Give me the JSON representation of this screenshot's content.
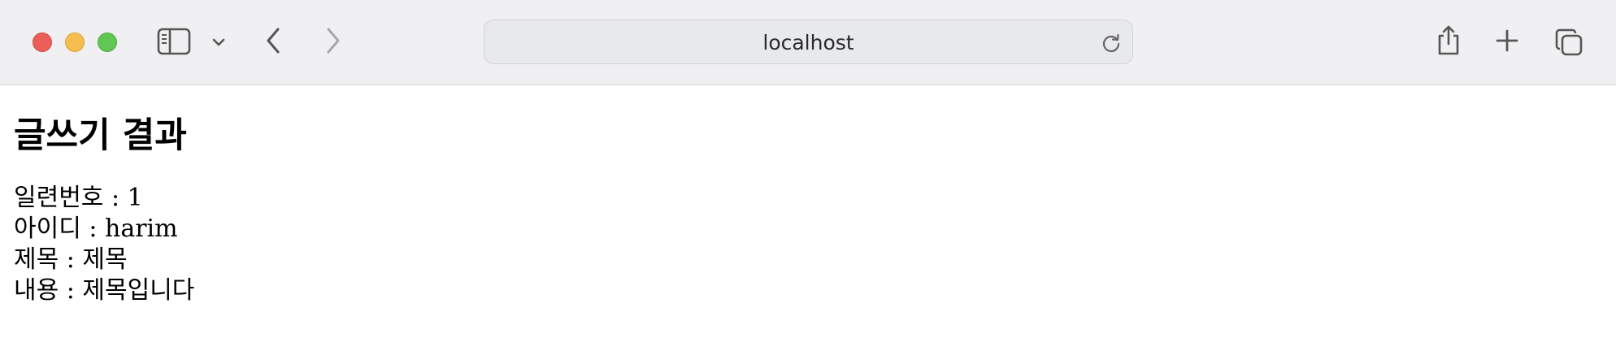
{
  "browser": {
    "address": "localhost"
  },
  "page": {
    "title": "글쓰기 결과",
    "rows": [
      {
        "label": "일련번호",
        "separator": " : ",
        "value": "1"
      },
      {
        "label": "아이디",
        "separator": " : ",
        "value": "harim"
      },
      {
        "label": "제목",
        "separator": " : ",
        "value": "제목"
      },
      {
        "label": "내용",
        "separator": " : ",
        "value": "제목입니다"
      }
    ]
  }
}
